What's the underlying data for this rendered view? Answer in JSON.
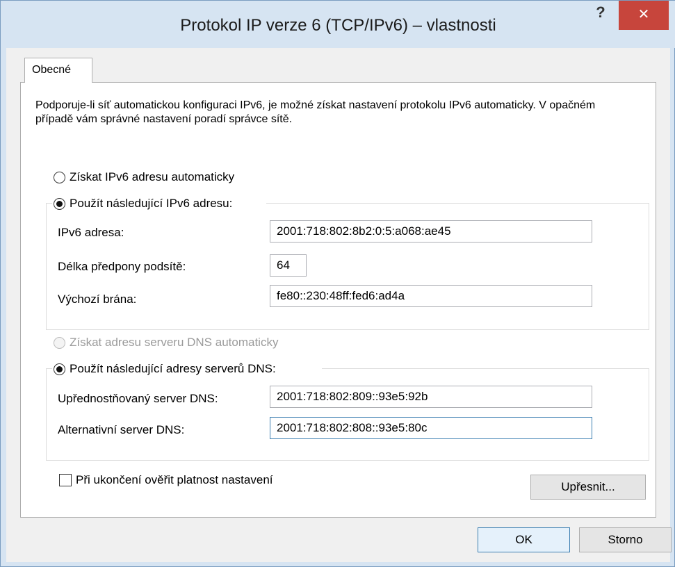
{
  "window": {
    "title": "Protokol IP verze 6 (TCP/IPv6) – vlastnosti",
    "help_glyph": "?",
    "close_glyph": "✕"
  },
  "tabs": [
    {
      "label": "Obecné",
      "selected": true
    }
  ],
  "intro_text": "Podporuje-li síť automatickou konfiguraci IPv6, je možné získat nastavení protokolu IPv6 automaticky. V opačném případě vám správné nastavení poradí správce sítě.",
  "ip_section": {
    "auto_label": "Získat IPv6 adresu automaticky",
    "auto_selected": false,
    "manual_label": "Použít následující IPv6 adresu:",
    "manual_selected": true,
    "fields": {
      "address_label": "IPv6 adresa:",
      "address_value": "2001:718:802:8b2:0:5:a068:ae45",
      "prefix_label": "Délka předpony podsítě:",
      "prefix_value": "64",
      "gateway_label": "Výchozí brána:",
      "gateway_value": "fe80::230:48ff:fed6:ad4a"
    }
  },
  "dns_section": {
    "auto_label": "Získat adresu serveru DNS automaticky",
    "auto_enabled": false,
    "manual_label": "Použít následující adresy serverů DNS:",
    "manual_selected": true,
    "fields": {
      "preferred_label": "Upřednostňovaný server DNS:",
      "preferred_value": "2001:718:802:809::93e5:92b",
      "alternate_label": "Alternativní server DNS:",
      "alternate_value": "2001:718:802:808::93e5:80c"
    }
  },
  "validate_checkbox": {
    "label": "Při ukončení ověřit platnost nastavení",
    "checked": false
  },
  "buttons": {
    "advanced": "Upřesnit...",
    "ok": "OK",
    "cancel": "Storno"
  },
  "colors": {
    "titlebar": "#d6e4f2",
    "close_button": "#c7453c",
    "focus_border": "#3c7fb1"
  }
}
